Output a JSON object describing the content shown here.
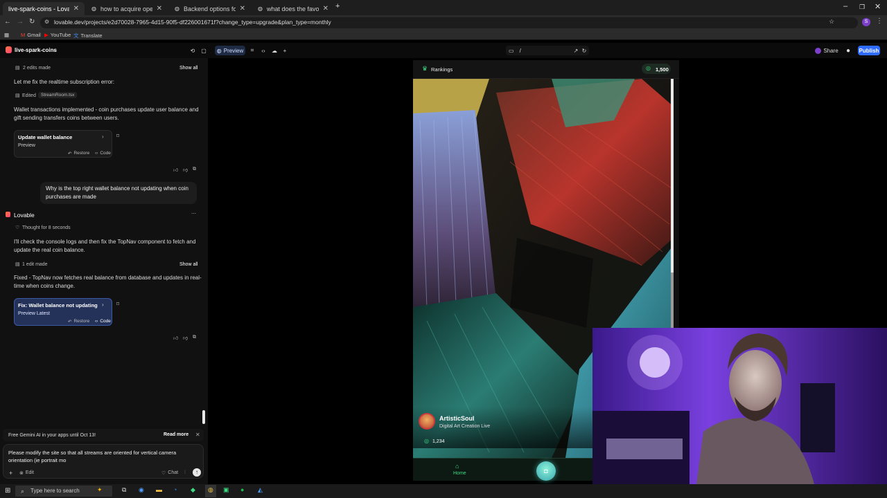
{
  "browser": {
    "tabs": [
      {
        "title": "live-spark-coins - Lovable",
        "active": true
      },
      {
        "title": "how to acquire openai api key"
      },
      {
        "title": "Backend options for livestream"
      },
      {
        "title": "what does the favorited app u"
      }
    ],
    "url": "lovable.dev/projects/e2d70028-7965-4d15-90f5-df226001671f?change_type=upgrade&plan_type=monthly",
    "bookmarks": [
      "Gmail",
      "YouTube",
      "Translate"
    ]
  },
  "app": {
    "project_name": "live-spark-coins",
    "preview_label": "Preview",
    "route_path": "/",
    "share_label": "Share",
    "publish_label": "Publish",
    "avatar_initial": "S"
  },
  "chat": {
    "edits_made_1": "2 edits made",
    "show_all_1": "Show all",
    "msg_1": "Let me fix the realtime subscription error:",
    "edited_label": "Edited",
    "edited_file": "StreamRoom.tsx",
    "msg_2": "Wallet transactions implemented - coin purchases update user balance and gift sending transfers coins between users.",
    "card_1_title": "Update wallet balance",
    "card_1_sub": "Preview",
    "restore_label": "Restore",
    "code_label": "Code",
    "user_msg": "Why is the top right wallet balance not updating when coin purchases are made",
    "assistant_name": "Lovable",
    "thought": "Thought for 8 seconds",
    "msg_3": "I'll check the console logs and then fix the TopNav component to fetch and update the real coin balance.",
    "edits_made_2": "1 edit made",
    "show_all_2": "Show all",
    "msg_4": "Fixed - TopNav now fetches real balance from database and updates in real-time when coins change.",
    "card_2_title": "Fix: Wallet balance not updating",
    "card_2_sub": "Preview Latest",
    "promo_text": "Free Gemini AI in your apps until Oct 13!",
    "promo_link": "Read more",
    "input_text": "Please modify the site so that all streams are oriented for vertical camera orientation (ie portrait mo",
    "edit_label": "Edit",
    "chat_label": "Chat"
  },
  "preview": {
    "rankings_label": "Rankings",
    "balance": "1,500",
    "streamer_name": "ArtisticSoul",
    "stream_title": "Digital Art Creation Live",
    "viewer_count": "1,234",
    "home_label": "Home"
  },
  "taskbar": {
    "search_placeholder": "Type here to search"
  },
  "colors": {
    "accent_green": "#3ddc84",
    "publish_blue": "#2f6bff",
    "lovable_pink": "#ff3e7a"
  }
}
